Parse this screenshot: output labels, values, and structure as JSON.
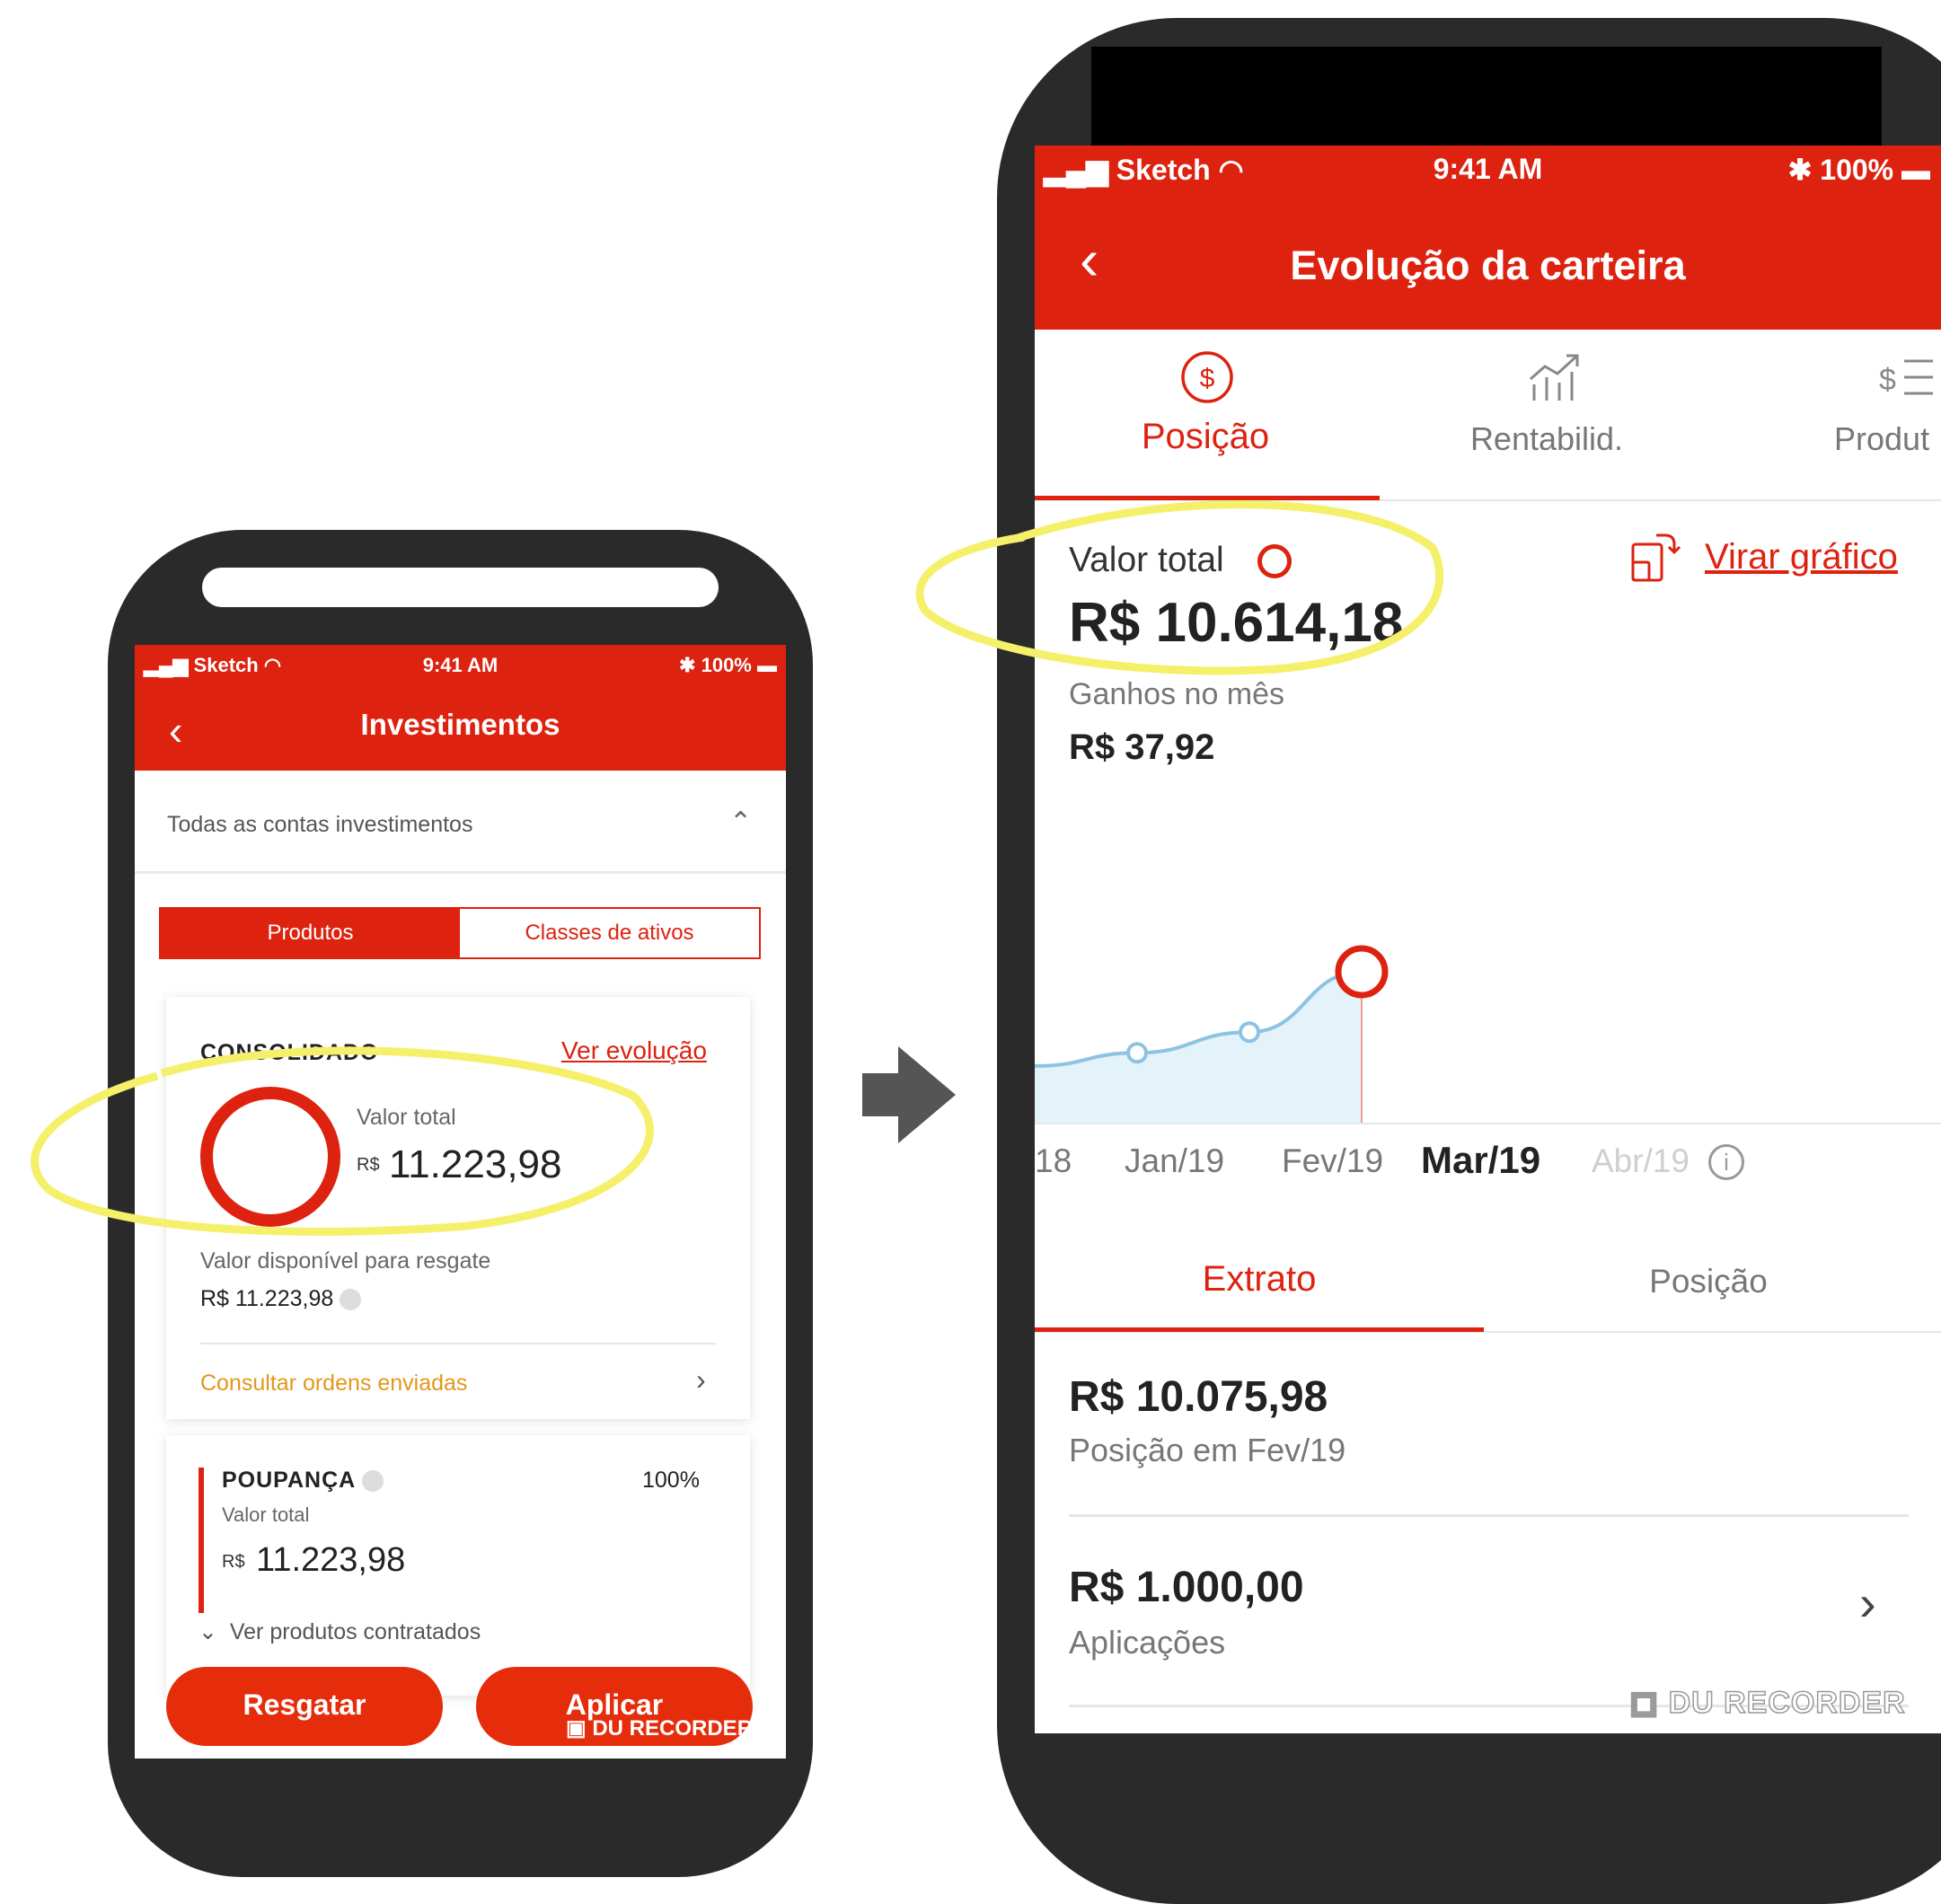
{
  "left_phone": {
    "status": {
      "carrier": "Sketch",
      "time": "9:41 AM",
      "battery": "100%"
    },
    "title": "Investimentos",
    "accounts_selector": "Todas as contas investimentos",
    "segmented": {
      "products": "Produtos",
      "asset_classes": "Classes de ativos"
    },
    "consolidated": {
      "heading": "CONSOLIDADO",
      "link": "Ver evolução",
      "total_label": "Valor total",
      "currency": "R$",
      "total_value": "11.223,98",
      "available_label": "Valor disponível para resgate",
      "available_value": "R$ 11.223,98",
      "orders_link": "Consultar ordens enviadas"
    },
    "savings": {
      "name": "POUPANÇA",
      "percent": "100%",
      "total_label": "Valor total",
      "currency": "R$",
      "total_value": "11.223,98",
      "expand_label": "Ver produtos contratados"
    },
    "buttons": {
      "redeem": "Resgatar",
      "apply": "Aplicar"
    },
    "watermark": "DU RECORDER"
  },
  "right_phone": {
    "status": {
      "carrier": "Sketch",
      "time": "9:41 AM",
      "battery": "100%"
    },
    "title": "Evolução da carteira",
    "tabs": [
      {
        "label": "Posição",
        "icon": "dollar-circle-icon",
        "active": true
      },
      {
        "label": "Rentabilid.",
        "icon": "bar-chart-up-icon",
        "active": false
      },
      {
        "label": "Produt",
        "icon": "dollar-list-icon",
        "active": false
      }
    ],
    "total_label": "Valor total",
    "total_value": "R$ 10.614,18",
    "gains_label": "Ganhos no mês",
    "gains_value": "R$ 37,92",
    "flip_chart": "Virar gráfico",
    "chart_data": {
      "type": "area",
      "x_labels": [
        "18",
        "Jan/19",
        "Fev/19",
        "Mar/19",
        "Abr/19"
      ],
      "selected": "Mar/19",
      "points_relative": [
        0.0,
        0.14,
        0.36,
        1.0
      ],
      "colors": {
        "line": "#8cc3e3",
        "fill": "#d9ecf7",
        "marker": "#dd2210"
      }
    },
    "subtabs": {
      "statement": "Extrato",
      "position": "Posição"
    },
    "entries": [
      {
        "value": "R$ 10.075,98",
        "label": "Posição em Fev/19"
      },
      {
        "value": "R$ 1.000,00",
        "label": "Aplicações"
      }
    ],
    "watermark": "DU RECORDER"
  },
  "colors": {
    "brand_red": "#dd2210",
    "orange_link": "#e3971b",
    "highlight": "#f5f06a"
  }
}
